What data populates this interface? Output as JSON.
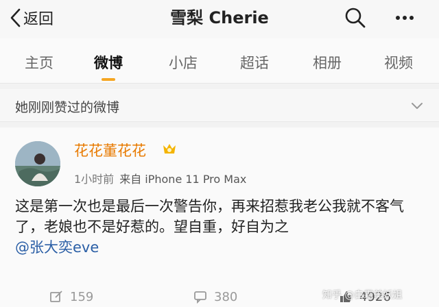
{
  "header": {
    "back_label": "返回",
    "title": "雪梨 Cherie",
    "icons": [
      "chevron-left-icon",
      "search-icon",
      "more-icon"
    ]
  },
  "tabs": [
    {
      "label": "主页",
      "active": false
    },
    {
      "label": "微博",
      "active": true
    },
    {
      "label": "小店",
      "active": false
    },
    {
      "label": "超话",
      "active": false
    },
    {
      "label": "相册",
      "active": false
    },
    {
      "label": "视频",
      "active": false
    }
  ],
  "section": {
    "label": "她刚刚赞过的微博"
  },
  "post": {
    "username": "花花董花花",
    "time": "1小时前",
    "source": "来自 iPhone 11 Pro Max",
    "content": "这是第一次也是最后一次警告你，再来招惹我老公我就不客气了，老娘也不是好惹的。望自重，好自为之",
    "mention": "@张大奕eve",
    "repost_count": "159",
    "comment_count": "380",
    "like_count": "4926"
  },
  "watermark": "知乎 @白霜美妖姐",
  "colors": {
    "accent": "#f5a623",
    "username": "#e87a00",
    "mention": "#2b5fa6"
  }
}
